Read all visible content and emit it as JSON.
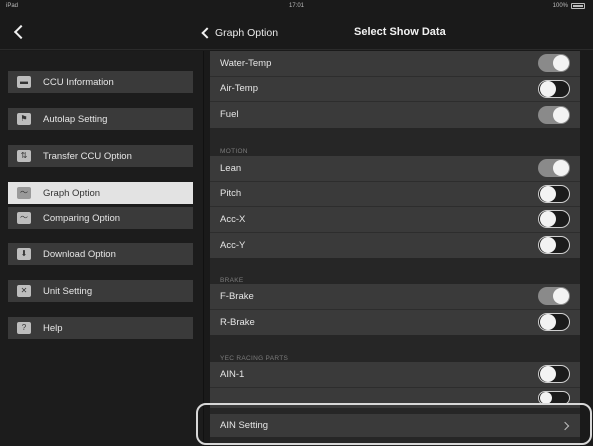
{
  "status": {
    "carrier": "iPad",
    "time": "17:01",
    "battery": "100%"
  },
  "nav": {
    "back_label": "Graph Option",
    "title": "Select Show Data"
  },
  "sidebar": {
    "items": [
      {
        "label": "CCU Information",
        "icon": "car-icon",
        "active": false
      },
      {
        "label": "Autolap Setting",
        "icon": "flag-icon",
        "active": false
      },
      {
        "label": "Transfer CCU Option",
        "icon": "transfer-icon",
        "active": false
      },
      {
        "label": "Graph Option",
        "icon": "graph-icon",
        "active": true
      },
      {
        "label": "Comparing Option",
        "icon": "compare-icon",
        "active": false
      },
      {
        "label": "Download Option",
        "icon": "download-icon",
        "active": false
      },
      {
        "label": "Unit Setting",
        "icon": "wrench-icon",
        "active": false
      },
      {
        "label": "Help",
        "icon": "help-icon",
        "active": false
      }
    ]
  },
  "groups": {
    "top": [
      {
        "label": "Water-Temp",
        "on": true
      },
      {
        "label": "Air-Temp",
        "on": false
      },
      {
        "label": "Fuel",
        "on": true
      }
    ],
    "motion": {
      "header": "MOTION",
      "rows": [
        {
          "label": "Lean",
          "on": true
        },
        {
          "label": "Pitch",
          "on": false
        },
        {
          "label": "Acc-X",
          "on": false
        },
        {
          "label": "Acc-Y",
          "on": false
        }
      ]
    },
    "brake": {
      "header": "BRAKE",
      "rows": [
        {
          "label": "F-Brake",
          "on": true
        },
        {
          "label": "R-Brake",
          "on": false
        }
      ]
    },
    "yec": {
      "header": "YEC RACING PARTS",
      "rows": [
        {
          "label": "AIN-1",
          "on": false
        }
      ]
    }
  },
  "ain_setting": {
    "label": "AIN Setting"
  }
}
